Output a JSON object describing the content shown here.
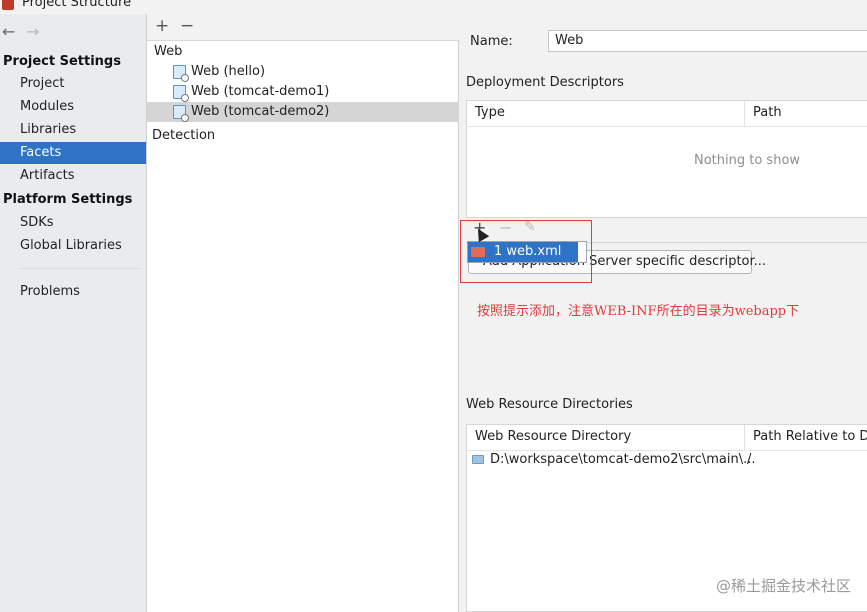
{
  "window": {
    "title": "Project Structure"
  },
  "sidebar": {
    "project_settings_header": "Project Settings",
    "project_items": [
      "Project",
      "Modules",
      "Libraries",
      "Facets",
      "Artifacts"
    ],
    "selected": "Facets",
    "platform_settings_header": "Platform Settings",
    "platform_items": [
      "SDKs",
      "Global Libraries"
    ],
    "problems": "Problems"
  },
  "facets_tree": {
    "root": "Web",
    "items": [
      "Web (hello)",
      "Web (tomcat-demo1)",
      "Web (tomcat-demo2)"
    ],
    "selected": "Web (tomcat-demo2)",
    "detection": "Detection"
  },
  "detail": {
    "name_label": "Name:",
    "name_value": "Web",
    "deployment_descriptors": {
      "header": "Deployment Descriptors",
      "columns": [
        "Type",
        "Path"
      ],
      "empty_text": "Nothing to show"
    },
    "popup_item": "1  web.xml",
    "add_button": "Add Application Server specific descriptor...",
    "annotation": "按照提示添加，注意WEB-INF所在的目录为webapp下",
    "web_resources": {
      "header": "Web Resource Directories",
      "columns": [
        "Web Resource Directory",
        "Path Relative to D"
      ],
      "rows": [
        {
          "directory": "D:\\workspace\\tomcat-demo2\\src\\main\\...",
          "relative": "/"
        }
      ]
    }
  },
  "watermark": "@稀土掘金技术社区",
  "icons": {
    "back": "←",
    "forward": "→",
    "plus": "+",
    "minus": "−",
    "edit": "✎"
  },
  "colors": {
    "selection": "#2f73c6",
    "annotation": "#e23a3a"
  }
}
